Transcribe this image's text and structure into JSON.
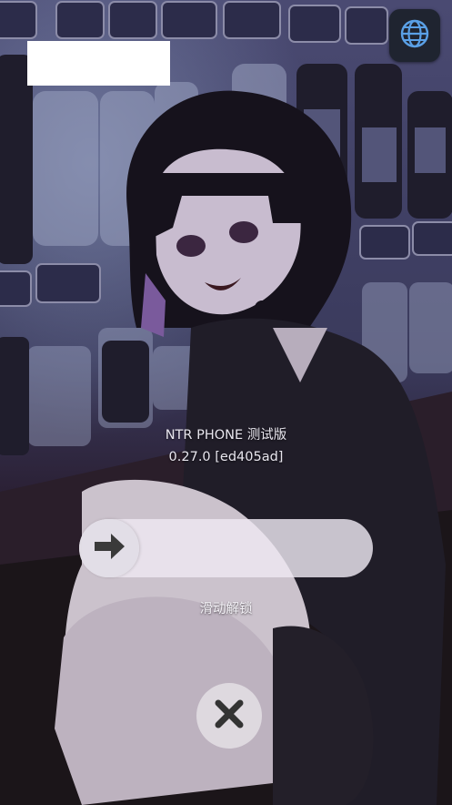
{
  "app": {
    "version_title": "NTR PHONE 测试版",
    "version_number": "0.27.0 [ed405ad]"
  },
  "lock": {
    "slide_hint": "滑动解锁"
  },
  "icons": {
    "language": "globe-icon",
    "slider": "arrow-right-icon",
    "close": "close-icon"
  },
  "colors": {
    "overlay": "#14121c",
    "slider_track": "#eee8f2",
    "knob_icon": "#3a3a3a",
    "lang_button_bg": "#1f2430",
    "lang_icon": "#5aa0e6"
  }
}
